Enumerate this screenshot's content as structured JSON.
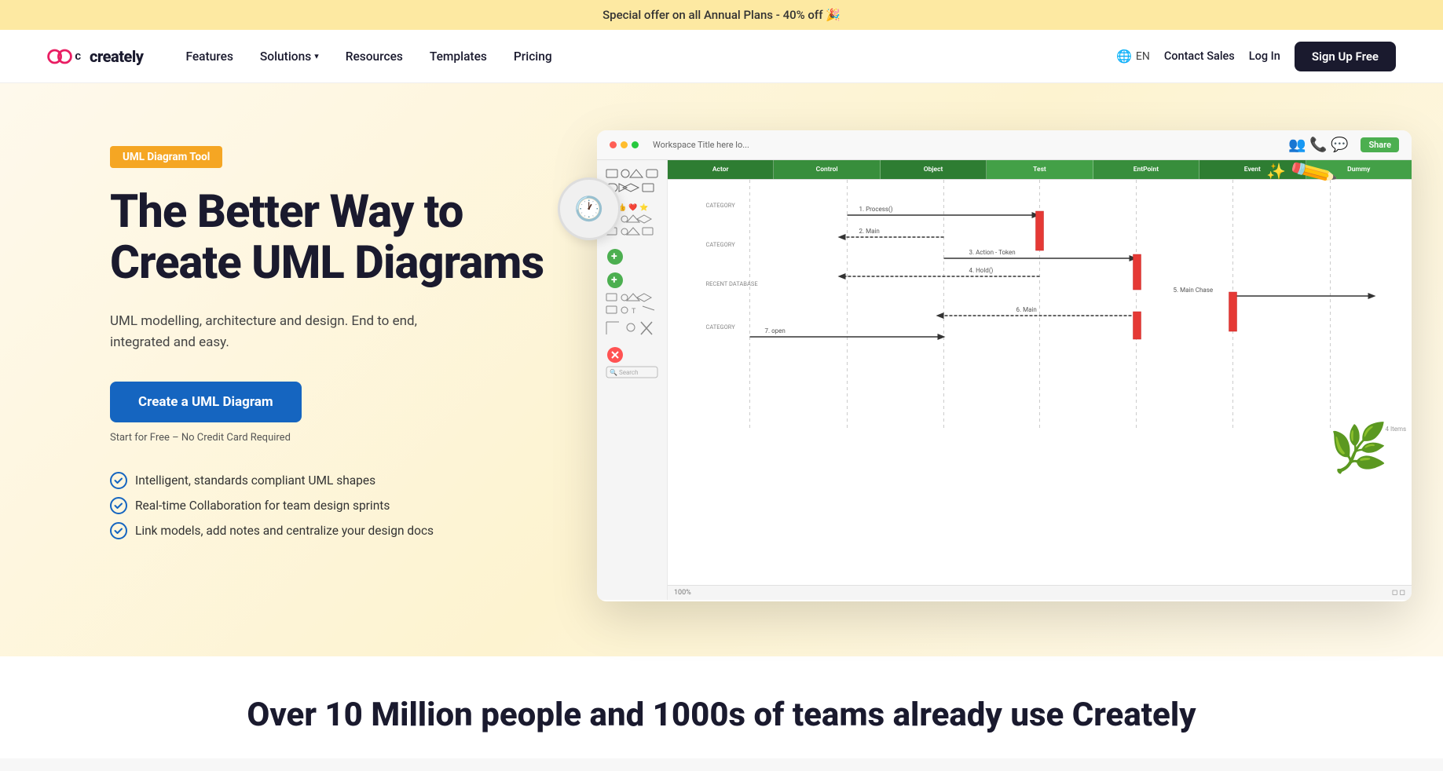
{
  "banner": {
    "text": "Special offer on all Annual Plans - 40% off 🎉"
  },
  "nav": {
    "logo_text": "creately",
    "links": [
      {
        "label": "Features",
        "has_dropdown": false
      },
      {
        "label": "Solutions",
        "has_dropdown": true
      },
      {
        "label": "Resources",
        "has_dropdown": false
      },
      {
        "label": "Templates",
        "has_dropdown": false
      },
      {
        "label": "Pricing",
        "has_dropdown": false
      }
    ],
    "lang_label": "EN",
    "contact_label": "Contact Sales",
    "login_label": "Log In",
    "signup_label": "Sign Up Free"
  },
  "hero": {
    "badge": "UML Diagram Tool",
    "title": "The Better Way to Create UML Diagrams",
    "description": "UML modelling, architecture and design. End to end, integrated and easy.",
    "cta_label": "Create a UML Diagram",
    "free_note": "Start for Free – No Credit Card Required",
    "features": [
      "Intelligent, standards compliant UML shapes",
      "Real-time Collaboration for team design sprints",
      "Link models, add notes and centralize your design docs"
    ]
  },
  "diagram": {
    "toolbar_title": "Workspace Title here lo...",
    "share_label": "Share",
    "actors": [
      "Actor",
      "Control",
      "Object",
      "Test",
      "EntPoint",
      "Event",
      "Dummy"
    ]
  },
  "bottom": {
    "title": "Over 10 Million people and 1000s of teams already use Creately"
  }
}
